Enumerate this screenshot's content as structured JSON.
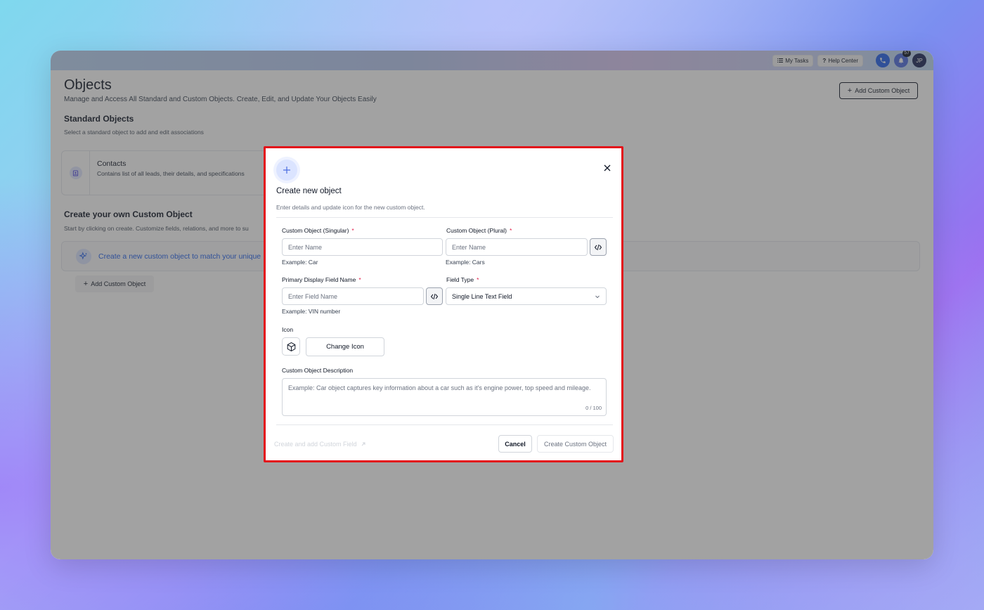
{
  "topbar": {
    "my_tasks": "My Tasks",
    "help_center": "Help Center",
    "notification_count": "57",
    "avatar_initials": "JP"
  },
  "page": {
    "title": "Objects",
    "subtitle": "Manage and Access All Standard and Custom Objects. Create, Edit, and Update Your Objects Easily",
    "add_custom_object_label": "Add Custom Object",
    "standard_section_title": "Standard Objects",
    "standard_section_subtitle": "Select a standard object to add and edit associations",
    "contacts_card": {
      "name": "Contacts",
      "description": "Contains list of all leads, their details, and specifications"
    },
    "custom_section_title": "Create your own Custom Object",
    "custom_section_subtitle": "Start by clicking on create. Customize fields, relations, and more to su",
    "banner_text": "Create a new custom object to match your unique",
    "add_custom_object_link": "Add Custom Object"
  },
  "modal": {
    "title": "Create new object",
    "subtitle": "Enter details and update icon for the new custom object.",
    "singular": {
      "label": "Custom Object (Singular)",
      "placeholder": "Enter Name",
      "hint": "Example: Car"
    },
    "plural": {
      "label": "Custom Object (Plural)",
      "placeholder": "Enter Name",
      "hint": "Example: Cars"
    },
    "primary_field": {
      "label": "Primary Display Field Name",
      "placeholder": "Enter Field Name",
      "hint": "Example: VIN number"
    },
    "field_type": {
      "label": "Field Type",
      "value": "Single Line Text Field"
    },
    "icon": {
      "label": "Icon",
      "change_label": "Change Icon",
      "current_icon": "cube-icon"
    },
    "description": {
      "label": "Custom Object Description",
      "placeholder": "Example: Car object captures key information about a car such as it's engine power, top speed and mileage.",
      "counter": "0 / 100"
    },
    "footer": {
      "create_and_add_link": "Create and add Custom Field",
      "cancel_label": "Cancel",
      "create_label": "Create Custom Object"
    },
    "required_marker": "*"
  },
  "colors": {
    "highlight_border": "#e3111a",
    "accent_blue": "#2563eb",
    "required_red": "#e11d48"
  }
}
